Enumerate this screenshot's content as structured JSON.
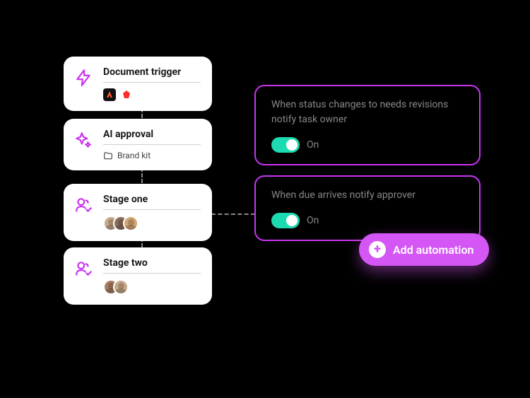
{
  "stages": [
    {
      "title": "Document trigger",
      "meta_text": ""
    },
    {
      "title": "AI approval",
      "meta_text": "Brand kit"
    },
    {
      "title": "Stage one",
      "meta_text": ""
    },
    {
      "title": "Stage two",
      "meta_text": ""
    }
  ],
  "automations": [
    {
      "text": "When status changes to needs revisions notify task owner",
      "state_label": "On",
      "enabled": true
    },
    {
      "text": "When due arrives notify approver",
      "state_label": "On",
      "enabled": true
    }
  ],
  "add_button": {
    "label": "Add automation"
  },
  "colors": {
    "accent": "#c934f0",
    "button": "#d457f5",
    "toggle_on": "#1ddbb0"
  }
}
